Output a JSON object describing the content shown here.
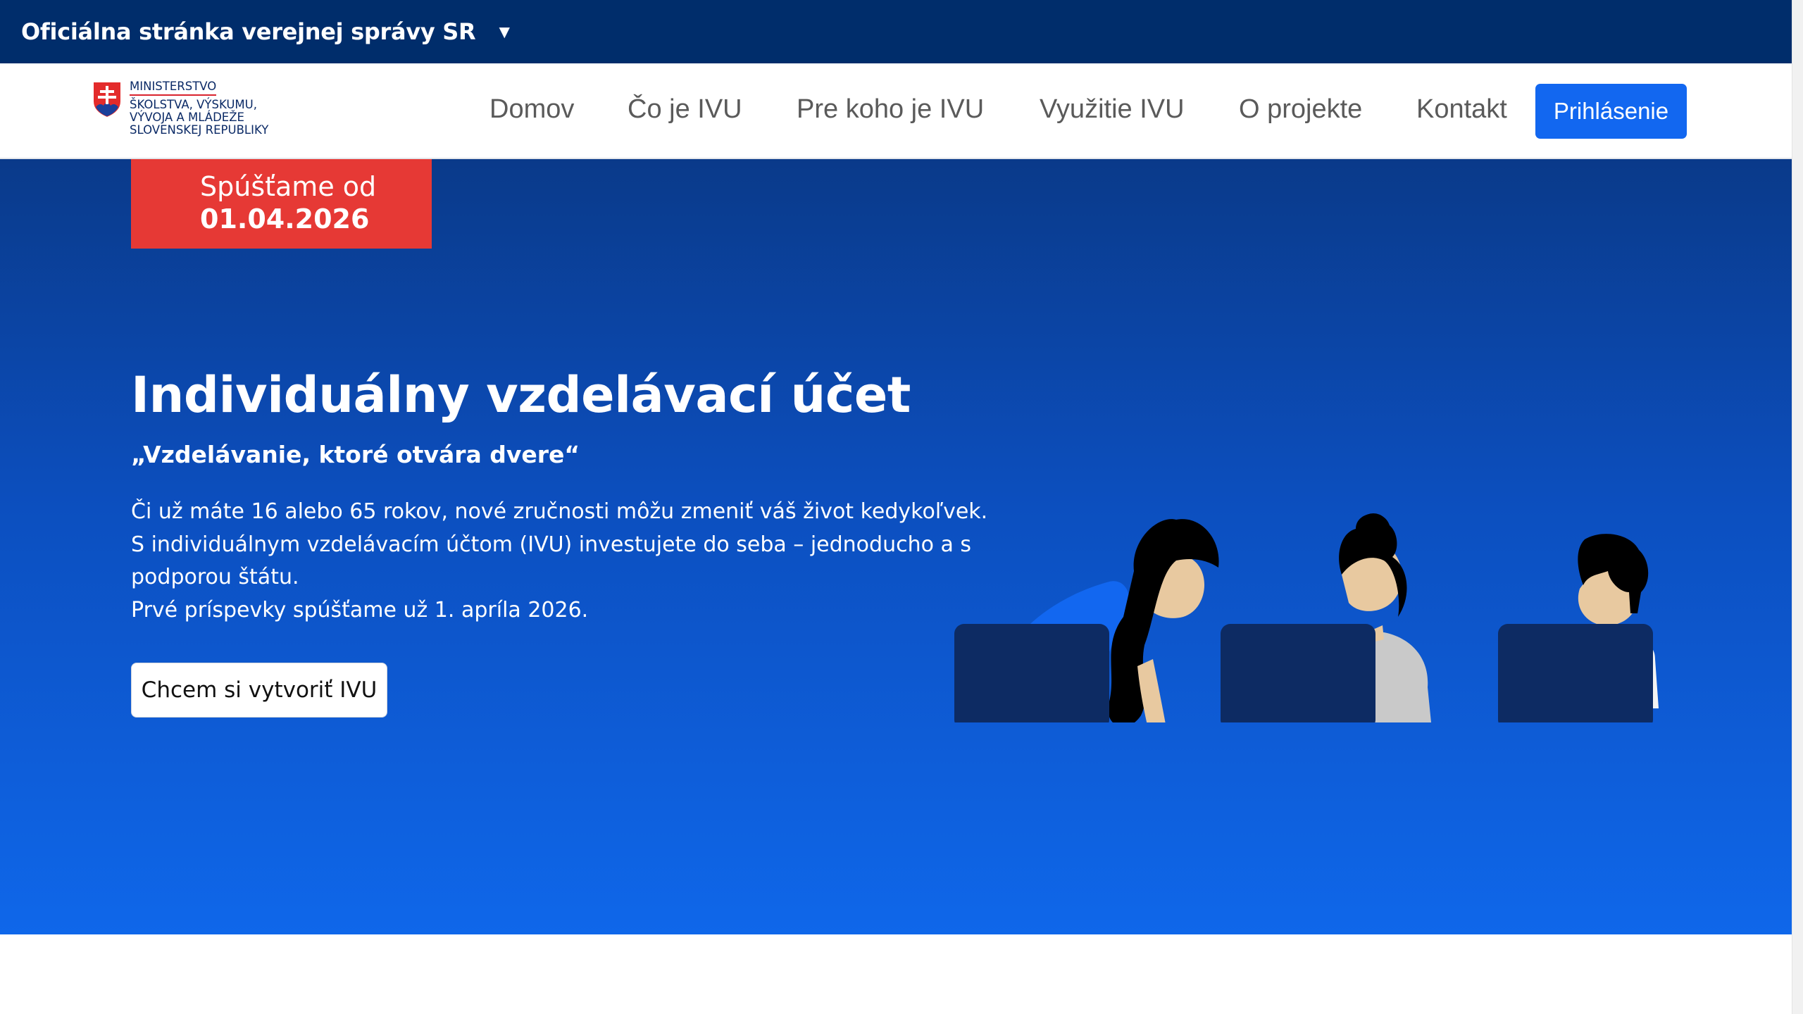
{
  "gov_bar": {
    "text": "Oficiálna stránka verejnej správy SR",
    "toggle_icon": "caret-down-icon"
  },
  "header": {
    "logo": {
      "line1": "MINISTERSTVO",
      "line2": "ŠKOLSTVA, VÝSKUMU,",
      "line3": "VÝVOJA A MLÁDEŽE",
      "line4": "SLOVENSKEJ REPUBLIKY",
      "emblem_icon": "slovak-coat-of-arms-icon"
    },
    "nav": [
      {
        "label": "Domov"
      },
      {
        "label": "Čo je IVU"
      },
      {
        "label": "Pre koho je IVU"
      },
      {
        "label": "Využitie IVU"
      },
      {
        "label": "O projekte"
      },
      {
        "label": "Kontakt"
      }
    ],
    "login_label": "Prihlásenie"
  },
  "hero": {
    "badge": {
      "line1": "Spúšťame od",
      "line2": "01.04.2026"
    },
    "title": "Individuálny vzdelávací účet",
    "quote": "„Vzdelávanie, ktoré otvára dvere“",
    "text_lines": [
      "Či už máte 16 alebo 65 rokov, nové zručnosti môžu zmeniť váš život kedykoľvek.",
      "S individuálnym vzdelávacím účtom (IVU) investujete do seba – jednoducho a s",
      "podporou štátu.",
      "Prvé príspevky spúšťame už 1. apríla 2026."
    ],
    "cta_label": "Chcem si vytvoriť IVU",
    "illustration": "three-people-at-laptops-illustration"
  },
  "colors": {
    "gov_bar": "#002d6b",
    "accent": "#1267f0",
    "badge": "#e63935",
    "hero_top": "#0a3a8a",
    "hero_bottom": "#0f67ea"
  }
}
